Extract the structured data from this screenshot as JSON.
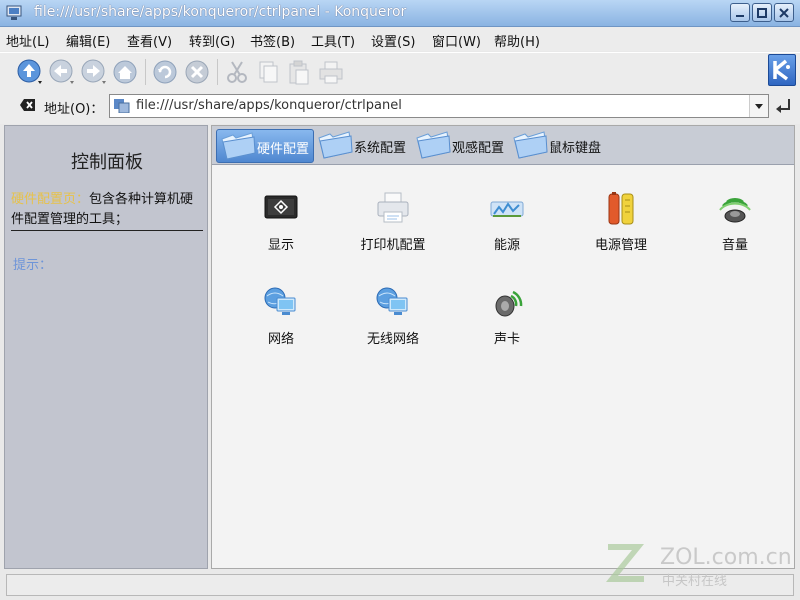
{
  "window": {
    "title": "file:///usr/share/apps/konqueror/ctrlpanel - Konqueror"
  },
  "menubar": {
    "items": [
      {
        "label": "地址(L)"
      },
      {
        "label": "编辑(E)"
      },
      {
        "label": "查看(V)"
      },
      {
        "label": "转到(G)"
      },
      {
        "label": "书签(B)"
      },
      {
        "label": "工具(T)"
      },
      {
        "label": "设置(S)"
      },
      {
        "label": "窗口(W)"
      },
      {
        "label": "帮助(H)"
      }
    ]
  },
  "toolbar": {
    "icons": [
      "up-arrow-icon",
      "back-arrow-icon",
      "forward-arrow-icon",
      "home-icon",
      "reload-icon",
      "stop-icon",
      "cut-icon",
      "copy-icon",
      "paste-icon",
      "print-icon",
      "kde-logo-icon"
    ]
  },
  "location": {
    "label": "地址(O)：",
    "url": "file:///usr/share/apps/konqueror/ctrlpanel"
  },
  "sidebar": {
    "title": "控制面板",
    "desc_highlight": "硬件配置页：",
    "desc_text": "包含各种计算机硬件配置管理的工具；",
    "tip": "提示："
  },
  "tabs": [
    {
      "label": "硬件配置",
      "active": true
    },
    {
      "label": "系统配置",
      "active": false
    },
    {
      "label": "观感配置",
      "active": false
    },
    {
      "label": "鼠标键盘",
      "active": false
    }
  ],
  "items": [
    {
      "label": "显示",
      "icon": "display-icon"
    },
    {
      "label": "打印机配置",
      "icon": "printer-icon"
    },
    {
      "label": "能源",
      "icon": "energy-icon"
    },
    {
      "label": "电源管理",
      "icon": "battery-icon"
    },
    {
      "label": "音量",
      "icon": "volume-icon"
    },
    {
      "label": "网络",
      "icon": "network-icon"
    },
    {
      "label": "无线网络",
      "icon": "wireless-icon"
    },
    {
      "label": "声卡",
      "icon": "sound-card-icon"
    }
  ],
  "watermark": {
    "site": "ZOL.com.cn",
    "site_cn": "中关村在线"
  },
  "colors": {
    "titlebar": "#8ab3e2",
    "tab_active": "#4f87d0",
    "sidebar": "#c2c5cf",
    "highlight": "#e7c24a",
    "tip": "#6e95d8"
  }
}
